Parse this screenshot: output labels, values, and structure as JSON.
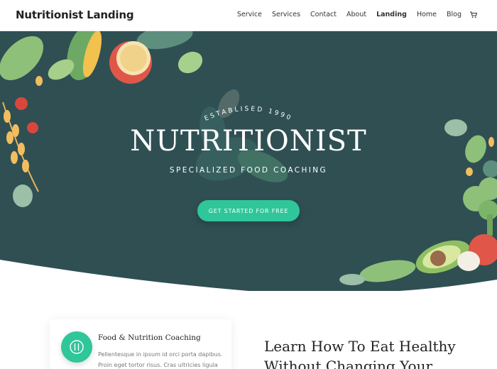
{
  "header": {
    "logo": "Nutritionist Landing",
    "nav": [
      "Service",
      "Services",
      "Contact",
      "About",
      "Landing",
      "Home",
      "Blog"
    ],
    "active_nav": "Landing",
    "cart_icon": "cart-icon"
  },
  "hero": {
    "established": "ESTABLISED 1990",
    "title": "NUTRITIONIST",
    "subtitle": "SPECIALIZED FOOD COACHING",
    "cta_label": "GET STARTED FOR FREE",
    "background_color": "#2f4f53",
    "accent_color": "#2fc69a"
  },
  "feature_card": {
    "icon": "cutlery-icon",
    "title": "Food & Nutrition Coaching",
    "text": "Pellentesque in ipsum id orci porta dapibus. Proin eget tortor risus. Cras ultricies ligula"
  },
  "section": {
    "heading_line1": "Learn How To Eat Healthy",
    "heading_line2": "Without Changing Your"
  }
}
